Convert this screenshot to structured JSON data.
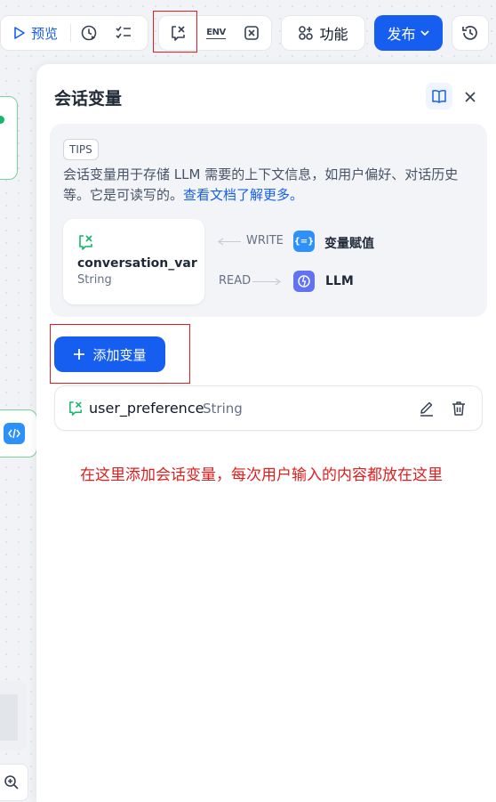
{
  "toolbar": {
    "preview_label": "预览",
    "function_label": "功能",
    "publish_label": "发布",
    "env_label": "ENV"
  },
  "panel": {
    "title": "会话变量",
    "tips": {
      "tag": "TIPS",
      "text": "会话变量用于存储 LLM 需要的上下文信息，如用户偏好、对话历史等。它是可读写的。",
      "link": "查看文档了解更多。"
    },
    "example": {
      "var_name": "conversation_var",
      "var_type": "String",
      "write_label": "WRITE",
      "read_label": "READ",
      "write_node": "变量赋值",
      "read_node": "LLM",
      "write_node_glyph": "{=}"
    },
    "add_button_label": "添加变量",
    "variables": [
      {
        "name": "user_preference",
        "type": "String"
      }
    ]
  },
  "annotation": {
    "note": "在这里添加会话变量，每次用户输入的内容都放在这里"
  },
  "colors": {
    "accent": "#155eef",
    "annotation_red": "#e11d1d",
    "canvas_node_border": "#7ad29a"
  }
}
